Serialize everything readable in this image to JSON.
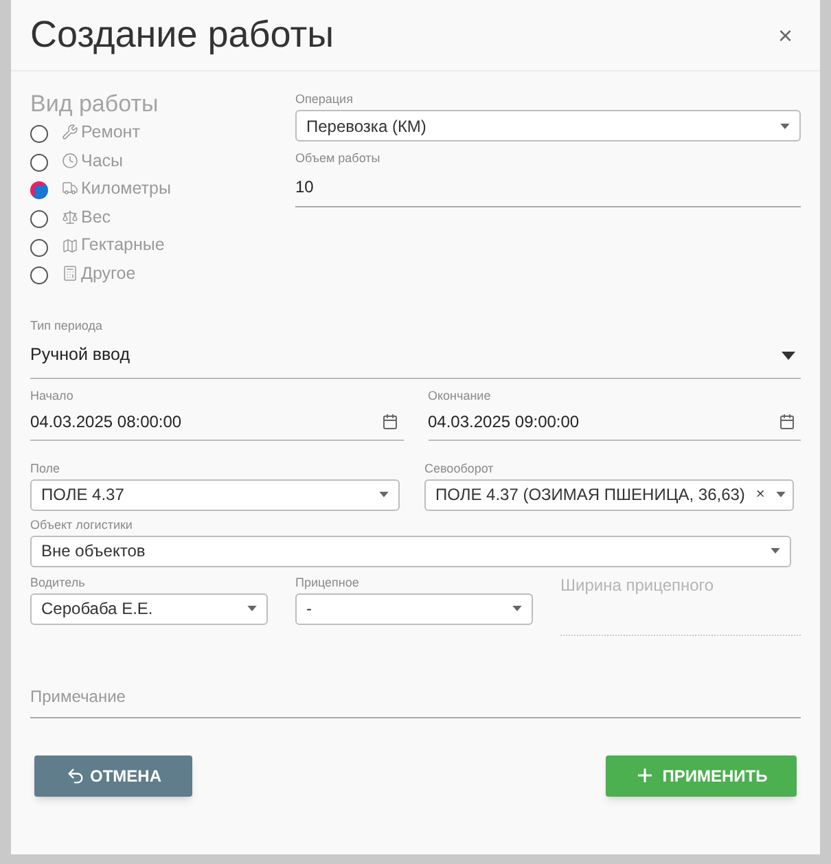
{
  "dialog": {
    "title": "Создание работы",
    "close": "×"
  },
  "work_type": {
    "label": "Вид работы",
    "options": [
      {
        "kind": "repair",
        "label": "Ремонт",
        "selected": false
      },
      {
        "kind": "hours",
        "label": "Часы",
        "selected": false
      },
      {
        "kind": "distance",
        "label": "Километры",
        "selected": true
      },
      {
        "kind": "weight",
        "label": "Вес",
        "selected": false
      },
      {
        "kind": "area",
        "label": "Гектарные",
        "selected": false
      },
      {
        "kind": "other",
        "label": "Другое",
        "selected": false
      }
    ]
  },
  "operation": {
    "label": "Операция",
    "value": "Перевозка (КМ)"
  },
  "volume": {
    "label": "Объем работы",
    "value": "10"
  },
  "period_type": {
    "label": "Тип периода",
    "value": "Ручной ввод"
  },
  "start": {
    "label": "Начало",
    "value": "04.03.2025 08:00:00"
  },
  "end": {
    "label": "Окончание",
    "value": "04.03.2025 09:00:00"
  },
  "field": {
    "label": "Поле",
    "value": "ПОЛЕ 4.37"
  },
  "rotation": {
    "label": "Севооборот",
    "value": "ПОЛЕ 4.37 (ОЗИМАЯ ПШЕНИЦА, 36,63)",
    "clear": "×"
  },
  "logistics": {
    "label": "Объект логистики",
    "value": "Вне объектов"
  },
  "driver": {
    "label": "Водитель",
    "value": "Серобаба Е.Е."
  },
  "trailer": {
    "label": "Прицепное",
    "value": "-"
  },
  "trailer_width": {
    "placeholder": "Ширина прицепного"
  },
  "note": {
    "placeholder": "Примечание"
  },
  "buttons": {
    "cancel": "ОТМЕНА",
    "apply": "ПРИМЕНИТЬ"
  }
}
